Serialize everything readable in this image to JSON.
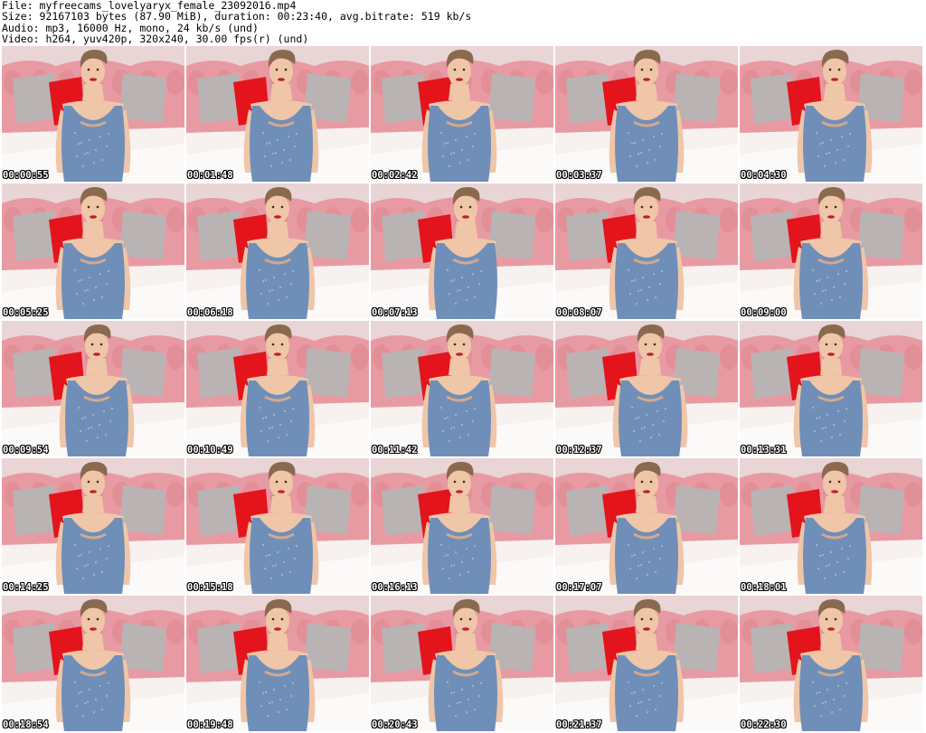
{
  "header": {
    "file_line": "File: myfreecams_lovelyaryx_female_23092016.mp4",
    "size_line": "Size: 92167103 bytes (87.90 MiB), duration: 00:23:40, avg.bitrate: 519 kb/s",
    "audio_line": "Audio: mp3, 16000 Hz, mono, 24 kb/s (und)",
    "video_line": "Video: h264, yuv420p, 320x240, 30.00 fps(r) (und)"
  },
  "thumbnails": [
    {
      "timestamp": "00:00:55"
    },
    {
      "timestamp": "00:01:48"
    },
    {
      "timestamp": "00:02:42"
    },
    {
      "timestamp": "00:03:37"
    },
    {
      "timestamp": "00:04:30"
    },
    {
      "timestamp": "00:05:25"
    },
    {
      "timestamp": "00:06:18"
    },
    {
      "timestamp": "00:07:13"
    },
    {
      "timestamp": "00:08:07"
    },
    {
      "timestamp": "00:09:00"
    },
    {
      "timestamp": "00:09:54"
    },
    {
      "timestamp": "00:10:49"
    },
    {
      "timestamp": "00:11:42"
    },
    {
      "timestamp": "00:12:37"
    },
    {
      "timestamp": "00:13:31"
    },
    {
      "timestamp": "00:14:25"
    },
    {
      "timestamp": "00:15:18"
    },
    {
      "timestamp": "00:16:13"
    },
    {
      "timestamp": "00:17:07"
    },
    {
      "timestamp": "00:18:01"
    },
    {
      "timestamp": "00:18:54"
    },
    {
      "timestamp": "00:19:48"
    },
    {
      "timestamp": "00:20:43"
    },
    {
      "timestamp": "00:21:37"
    },
    {
      "timestamp": "00:22:30"
    }
  ],
  "colors": {
    "wall": "#efd9da",
    "headboard": "#e89aa3",
    "cushion_grey": "#b9b3b3",
    "cushion_red": "#e3141c",
    "bed": "#f7f1ef",
    "top": "#6f8fb8",
    "skin": "#f0c6a8",
    "hair": "#8a6a4e"
  }
}
